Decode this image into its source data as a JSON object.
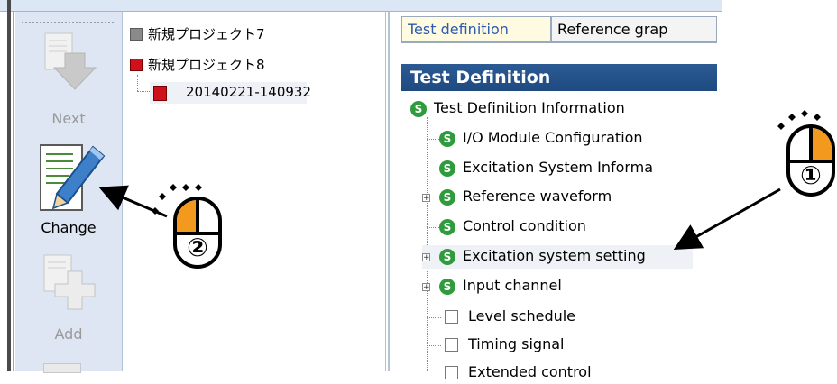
{
  "toolbar": {
    "next_label": "Next",
    "change_label": "Change",
    "add_label": "Add"
  },
  "project_tree": {
    "items": [
      {
        "label": "新規プロジェクト7"
      },
      {
        "label": "新規プロジェクト8"
      },
      {
        "label": "20140221-140932"
      }
    ]
  },
  "tabs": [
    {
      "label": "Test definition"
    },
    {
      "label": "Reference grap"
    }
  ],
  "panel": {
    "title": "Test Definition",
    "tree": [
      {
        "label": "Test Definition Information",
        "icon": "s-icon"
      },
      {
        "label": "I/O Module Configuration",
        "icon": "s-icon"
      },
      {
        "label": "Excitation System Informa",
        "icon": "s-icon"
      },
      {
        "label": "Reference waveform",
        "icon": "s-icon"
      },
      {
        "label": "Control condition",
        "icon": "s-icon"
      },
      {
        "label": "Excitation system setting",
        "icon": "s-icon"
      },
      {
        "label": "Input channel",
        "icon": "s-icon"
      },
      {
        "label": "Level schedule",
        "icon": "checkbox"
      },
      {
        "label": "Timing signal",
        "icon": "checkbox"
      },
      {
        "label": "Extended control",
        "icon": "checkbox"
      }
    ]
  },
  "callouts": {
    "step1": "①",
    "step2": "②"
  },
  "colors": {
    "accent_orange": "#f39a1e",
    "header_blue": "#1e4a80",
    "s_icon_green": "#2f9b3d",
    "project_red": "#d0101a"
  }
}
